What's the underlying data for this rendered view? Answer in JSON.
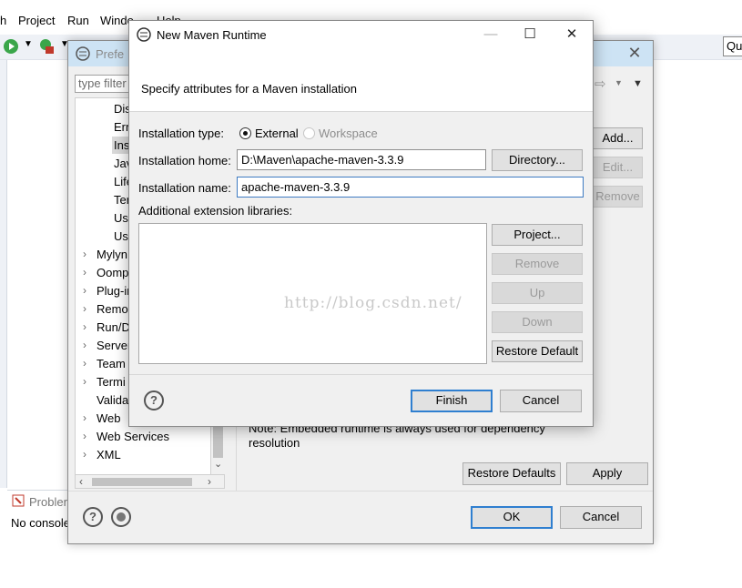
{
  "menu": [
    "h",
    "Project",
    "Run",
    "Windo",
    "Help"
  ],
  "quick_access": "Qu",
  "preferences": {
    "title": "Prefe",
    "filter_placeholder": "type filter",
    "tree": [
      {
        "label": "Dis",
        "arrow": false
      },
      {
        "label": "Err",
        "arrow": false
      },
      {
        "label": "Ins",
        "arrow": false,
        "selected": true
      },
      {
        "label": "Jav",
        "arrow": false
      },
      {
        "label": "Life",
        "arrow": false
      },
      {
        "label": "Ter",
        "arrow": false
      },
      {
        "label": "Us",
        "arrow": false
      },
      {
        "label": "Us",
        "arrow": false
      },
      {
        "label": "Mylyn",
        "arrow": true
      },
      {
        "label": "Oomp",
        "arrow": true
      },
      {
        "label": "Plug-ir",
        "arrow": true
      },
      {
        "label": "Remo",
        "arrow": true
      },
      {
        "label": "Run/D",
        "arrow": true
      },
      {
        "label": "Server",
        "arrow": true
      },
      {
        "label": "Team",
        "arrow": true
      },
      {
        "label": "Termi",
        "arrow": true
      },
      {
        "label": "Valida",
        "arrow": false
      },
      {
        "label": "Web",
        "arrow": true
      },
      {
        "label": "Web Services",
        "arrow": true
      },
      {
        "label": "XML",
        "arrow": true
      }
    ],
    "buttons": {
      "add": "Add...",
      "edit": "Edit...",
      "remove": "Remove",
      "restore_defaults": "Restore Defaults",
      "apply": "Apply",
      "ok": "OK",
      "cancel": "Cancel"
    },
    "note_line1": "Note: Embedded runtime is always used for dependency",
    "note_line2": "resolution",
    "problems_tab": "Probler",
    "console_text": "No console"
  },
  "maven_dialog": {
    "title": "New Maven Runtime",
    "description": "Specify attributes for a Maven installation",
    "installation_type_label": "Installation type:",
    "type_options": [
      {
        "label": "External",
        "selected": true
      },
      {
        "label": "Workspace",
        "selected": false
      }
    ],
    "home_label": "Installation home:",
    "home_value": "D:\\Maven\\apache-maven-3.3.9",
    "name_label": "Installation name:",
    "name_value": "apache-maven-3.3.9",
    "ext_label": "Additional extension libraries:",
    "watermark": "http://blog.csdn.net/",
    "buttons": {
      "directory": "Directory...",
      "project": "Project...",
      "remove": "Remove",
      "up": "Up",
      "down": "Down",
      "restore_default": "Restore Default",
      "finish": "Finish",
      "cancel": "Cancel"
    }
  }
}
